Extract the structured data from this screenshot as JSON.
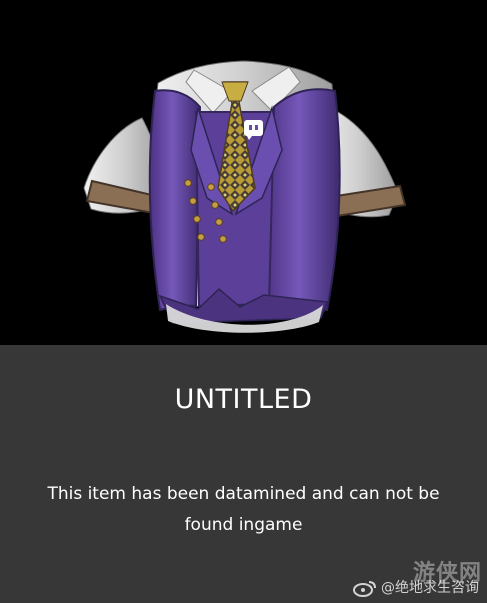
{
  "item": {
    "title": "UNTITLED",
    "description": "This item has been datamined and can not be found ingame",
    "image_subject": "purple vest shirt with patterned tie"
  },
  "watermark": {
    "text": "@绝地求生咨询",
    "stamp_text": "游侠网",
    "logo_icon": "weibo-icon"
  },
  "colors": {
    "background": "#000000",
    "panel": "#373737",
    "text": "#ffffff",
    "vest": "#6a4ca8",
    "shirt": "#d9d9d9",
    "tie": "#c7a735"
  }
}
